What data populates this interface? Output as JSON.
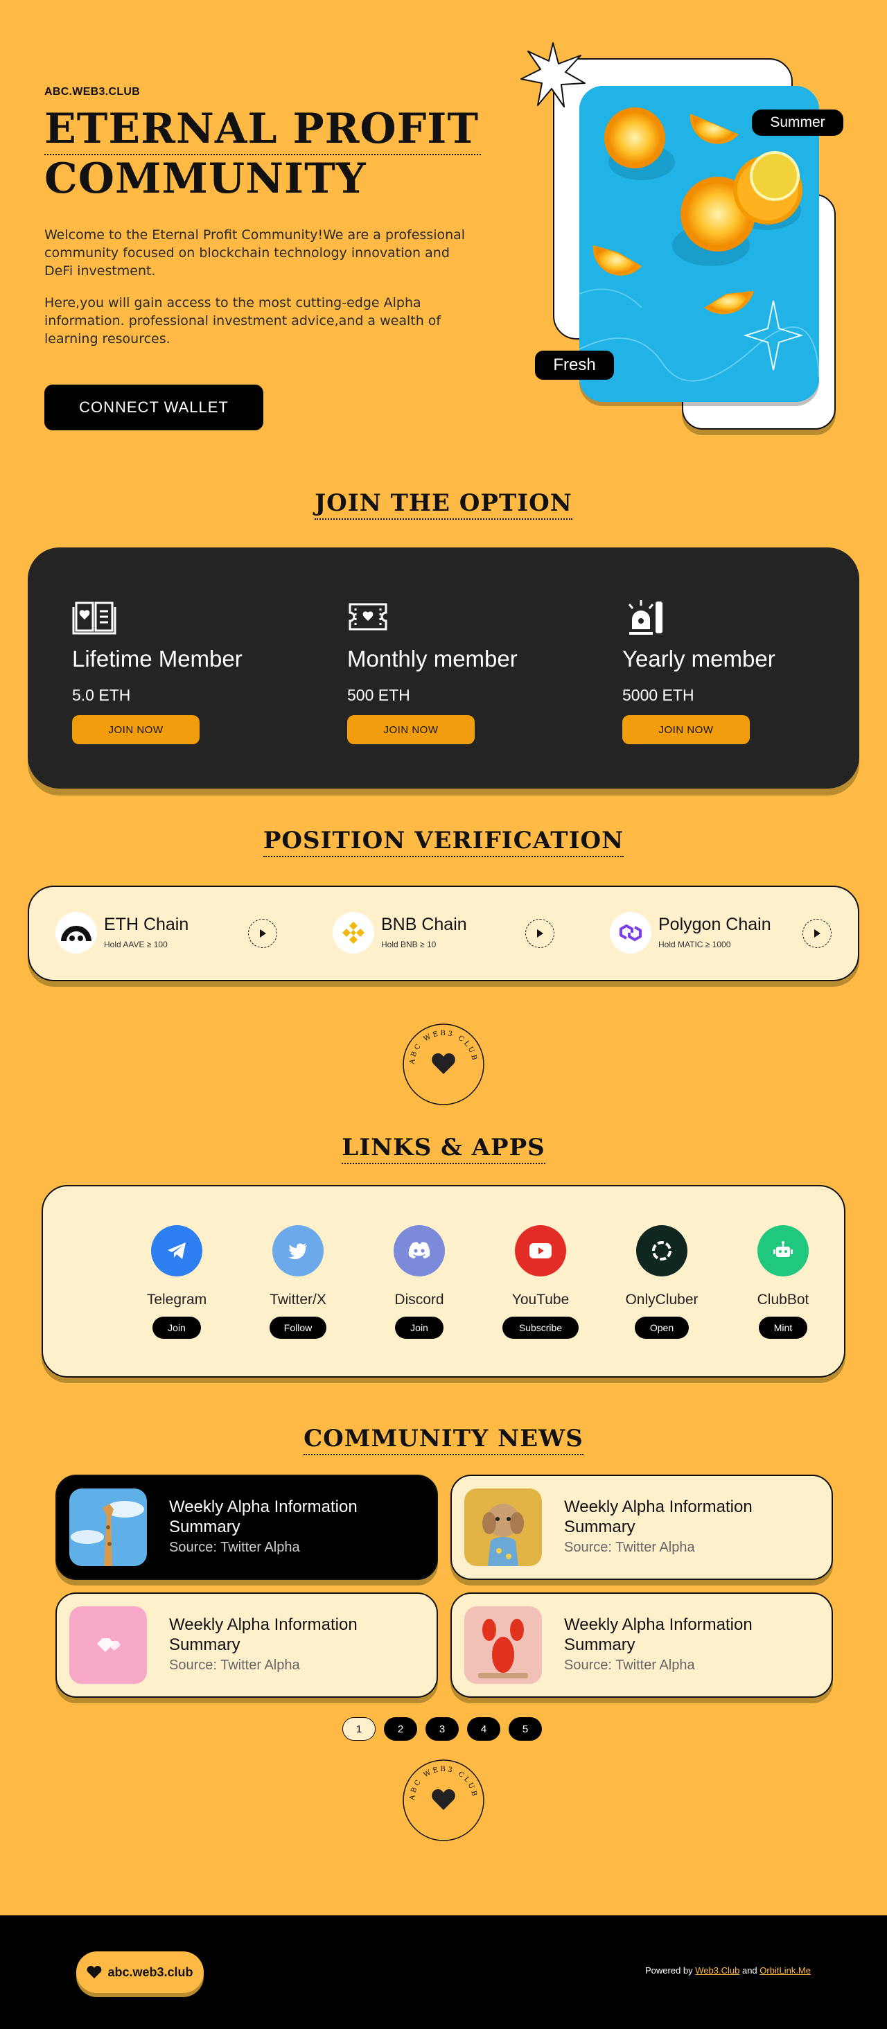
{
  "hero": {
    "brand": "ABC.WEB3.CLUB",
    "title_line1": "ETERNAL PROFIT",
    "title_line2": "COMMUNITY",
    "paragraph1": "Welcome to the Eternal Profit Community!We are a professional community focused on blockchain technology innovation and DeFi investment.",
    "paragraph2": "Here,you will gain access to the most cutting-edge Alpha information. professional investment advice,and a wealth of learning resources.",
    "connect_label": "CONNECT WALLET",
    "badge_summer": "Summer",
    "badge_fresh": "Fresh"
  },
  "join": {
    "title": "JOIN THE OPTION",
    "options": [
      {
        "title": "Lifetime Member",
        "price": "5.0 ETH",
        "button": "JOIN NOW",
        "icon": "book-heart-icon"
      },
      {
        "title": "Monthly member",
        "price": "500 ETH",
        "button": "JOIN NOW",
        "icon": "ticket-heart-icon"
      },
      {
        "title": "Yearly member",
        "price": "5000 ETH",
        "button": "JOIN NOW",
        "icon": "siren-icon"
      }
    ]
  },
  "verification": {
    "title": "POSITION VERIFICATION",
    "chains": [
      {
        "name": "ETH Chain",
        "requirement": "Hold AAVE ≥ 100",
        "icon": "aave-icon"
      },
      {
        "name": "BNB Chain",
        "requirement": "Hold BNB ≥ 10",
        "icon": "bnb-icon"
      },
      {
        "name": "Polygon Chain",
        "requirement": "Hold MATIC ≥ 1000",
        "icon": "polygon-icon"
      }
    ]
  },
  "seal_text": "ABC WEB3 CLUB",
  "links": {
    "title": "LINKS & APPS",
    "apps": [
      {
        "name": "Telegram",
        "button": "Join",
        "color": "#2d7ef0",
        "icon": "telegram-icon"
      },
      {
        "name": "Twitter/X",
        "button": "Follow",
        "color": "#6ca9ea",
        "icon": "twitter-icon"
      },
      {
        "name": "Discord",
        "button": "Join",
        "color": "#7b8bd9",
        "icon": "discord-icon"
      },
      {
        "name": "YouTube",
        "button": "Subscribe",
        "color": "#e32c25",
        "icon": "youtube-icon"
      },
      {
        "name": "OnlyCluber",
        "button": "Open",
        "color": "#0f2621",
        "icon": "onlycluber-icon"
      },
      {
        "name": "ClubBot",
        "button": "Mint",
        "color": "#1fc87e",
        "icon": "robot-icon"
      }
    ]
  },
  "news": {
    "title": "COMMUNITY NEWS",
    "items": [
      {
        "title": "Weekly Alpha Information Summary",
        "source": "Source: Twitter Alpha"
      },
      {
        "title": "Weekly Alpha Information Summary",
        "source": "Source: Twitter Alpha"
      },
      {
        "title": "Weekly Alpha Information Summary",
        "source": "Source: Twitter Alpha"
      },
      {
        "title": "Weekly Alpha Information Summary",
        "source": "Source: Twitter Alpha"
      }
    ],
    "pages": [
      "1",
      "2",
      "3",
      "4",
      "5"
    ],
    "active_page": "1"
  },
  "footer": {
    "logo_text": "abc.web3.club",
    "powered_prefix": "Powered by",
    "powered_link1": "Web3.Club",
    "powered_and": "and",
    "powered_link2": "OrbitLink.Me"
  },
  "colors": {
    "background": "#ffba45",
    "panel_dark": "#242424",
    "panel_light": "#fff0cc",
    "accent_button": "#f29d0d"
  }
}
